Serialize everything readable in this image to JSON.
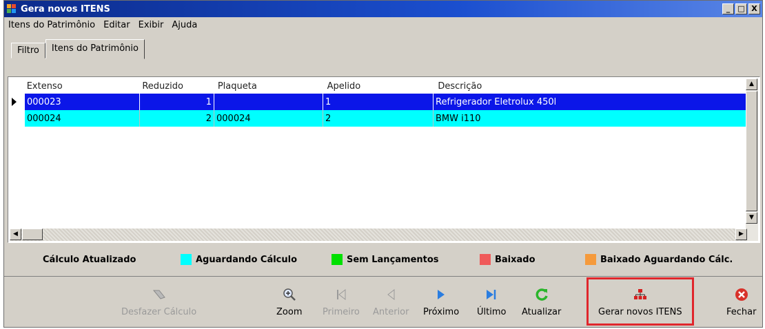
{
  "window": {
    "title": "Gera novos ITENS",
    "buttons": [
      "_",
      "□",
      "X"
    ]
  },
  "menu": [
    "Itens do Patrimônio",
    "Editar",
    "Exibir",
    "Ajuda"
  ],
  "tabs": [
    "Filtro",
    "Itens do Patrimônio"
  ],
  "grid": {
    "columns": [
      "Extenso",
      "Reduzido",
      "Plaqueta",
      "Apelido",
      "Descrição"
    ],
    "rows": [
      {
        "extenso": "000023",
        "reduzido": "1",
        "plaqueta": "",
        "apelido": "1",
        "descricao": "Refrigerador Eletrolux 450l"
      },
      {
        "extenso": "000024",
        "reduzido": "2",
        "plaqueta": "000024",
        "apelido": "2",
        "descricao": "BMW i110"
      }
    ]
  },
  "legend": [
    {
      "label": "Cálculo Atualizado",
      "color": ""
    },
    {
      "label": "Aguardando Cálculo",
      "color": "#00ffff"
    },
    {
      "label": "Sem Lançamentos",
      "color": "#00e000"
    },
    {
      "label": "Baixado",
      "color": "#f05a5a"
    },
    {
      "label": "Baixado Aguardando Cálc.",
      "color": "#f59a3c"
    }
  ],
  "toolbar": {
    "desfazer": "Desfazer Cálculo",
    "zoom": "Zoom",
    "primeiro": "Primeiro",
    "anterior": "Anterior",
    "proximo": "Próximo",
    "ultimo": "Último",
    "atualizar": "Atualizar",
    "gerar": "Gerar novos ITENS",
    "fechar": "Fechar"
  },
  "colors": {
    "selected_row": "#0b16e8",
    "alt_row": "#00ffff",
    "highlight": "#e0262c"
  }
}
